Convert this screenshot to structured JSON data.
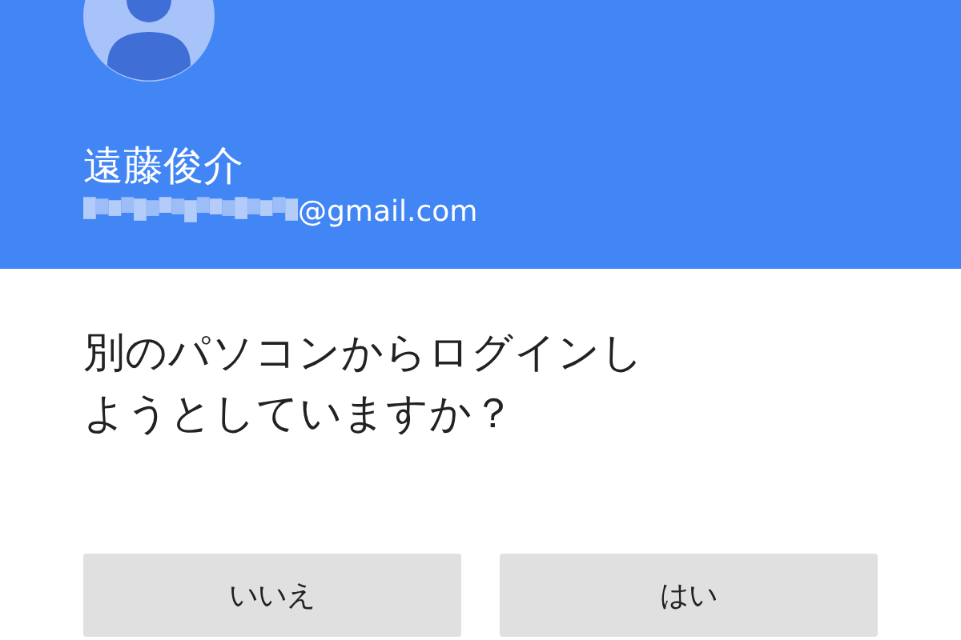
{
  "account": {
    "name": "遠藤俊介",
    "email": "@gmail.com"
  },
  "prompt": "別のパソコンからログインしようとしていますか？",
  "buttons": [
    {
      "label": "いいえ"
    },
    {
      "label": "はい"
    }
  ]
}
